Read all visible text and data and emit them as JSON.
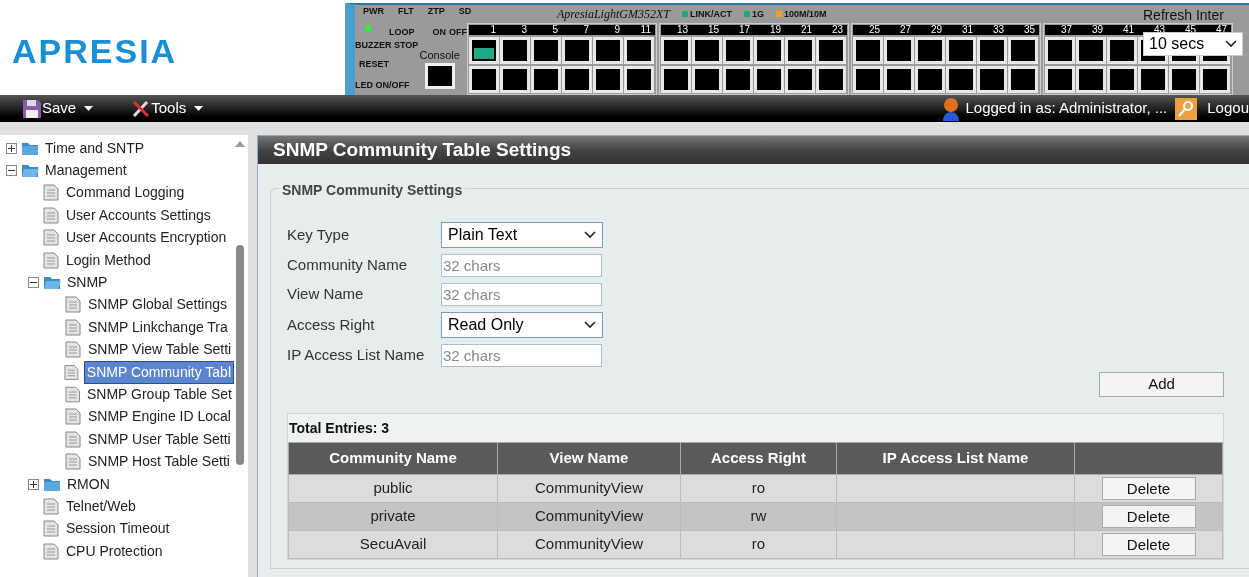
{
  "logo": "APRESIA",
  "device_panel": {
    "model": "ApresiaLightGM352XT",
    "leds": [
      "PWR",
      "FLT",
      "ZTP",
      "SD"
    ],
    "loop_label": "LOOP",
    "switch_labels": [
      "ON",
      "OFF"
    ],
    "buttons": [
      "BUZZER STOP",
      "RESET",
      "LED ON/OFF"
    ],
    "console": "Console",
    "legend": [
      {
        "label": "LINK/ACT",
        "color": "#22aa66"
      },
      {
        "label": "1G",
        "color": "#22aa66"
      },
      {
        "label": "100M/10M",
        "color": "#f0a020"
      }
    ],
    "port_groups": [
      {
        "ports": [
          {
            "label": "1",
            "link": true
          },
          {
            "label": "3",
            "link": false
          },
          {
            "label": "5",
            "link": false
          },
          {
            "label": "7",
            "link": false
          },
          {
            "label": "9",
            "link": false
          },
          {
            "label": "11",
            "link": false
          }
        ]
      },
      {
        "ports": [
          {
            "label": "13",
            "link": false
          },
          {
            "label": "15",
            "link": false
          },
          {
            "label": "17",
            "link": false
          },
          {
            "label": "19",
            "link": false
          },
          {
            "label": "21",
            "link": false
          },
          {
            "label": "23",
            "link": false
          }
        ]
      },
      {
        "ports": [
          {
            "label": "25",
            "link": false
          },
          {
            "label": "27",
            "link": false
          },
          {
            "label": "29",
            "link": false
          },
          {
            "label": "31",
            "link": false
          },
          {
            "label": "33",
            "link": false
          },
          {
            "label": "35",
            "link": false
          }
        ]
      },
      {
        "ports": [
          {
            "label": "37",
            "link": false
          },
          {
            "label": "39",
            "link": false
          },
          {
            "label": "41",
            "link": false
          },
          {
            "label": "43",
            "link": false
          },
          {
            "label": "45",
            "link": false
          },
          {
            "label": "47",
            "link": false
          }
        ]
      }
    ]
  },
  "refresh": {
    "label": "Refresh Inter",
    "value": "10 secs"
  },
  "toolbar": {
    "menus": [
      "Save",
      "Tools"
    ],
    "user": "Logged in as: Administrator, ...",
    "logout": "Logou"
  },
  "tree": [
    {
      "label": "Time and SNTP",
      "kind": "folder",
      "expanded": false,
      "selected": false
    },
    {
      "label": "Management",
      "kind": "folder",
      "expanded": true,
      "selected": false,
      "children": [
        {
          "label": "Command Logging",
          "kind": "page",
          "selected": false
        },
        {
          "label": "User Accounts Settings",
          "kind": "page",
          "selected": false
        },
        {
          "label": "User Accounts Encryption",
          "kind": "page",
          "selected": false
        },
        {
          "label": "Login Method",
          "kind": "page",
          "selected": false
        },
        {
          "label": "SNMP",
          "kind": "folder",
          "expanded": true,
          "selected": false,
          "children": [
            {
              "label": "SNMP Global Settings",
              "kind": "page",
              "selected": false
            },
            {
              "label": "SNMP Linkchange Tra",
              "kind": "page",
              "selected": false
            },
            {
              "label": "SNMP View Table Setti",
              "kind": "page",
              "selected": false
            },
            {
              "label": "SNMP Community Tabl",
              "kind": "page",
              "selected": true
            },
            {
              "label": "SNMP Group Table Set",
              "kind": "page",
              "selected": false
            },
            {
              "label": "SNMP Engine ID Local",
              "kind": "page",
              "selected": false
            },
            {
              "label": "SNMP User Table Setti",
              "kind": "page",
              "selected": false
            },
            {
              "label": "SNMP Host Table Setti",
              "kind": "page",
              "selected": false
            }
          ]
        },
        {
          "label": "RMON",
          "kind": "folder",
          "expanded": false,
          "selected": false
        },
        {
          "label": "Telnet/Web",
          "kind": "page",
          "selected": false
        },
        {
          "label": "Session Timeout",
          "kind": "page",
          "selected": false
        },
        {
          "label": "CPU Protection",
          "kind": "page",
          "selected": false
        }
      ]
    }
  ],
  "page_title": "SNMP Community Table Settings",
  "fieldset": {
    "legend": "SNMP Community Settings",
    "fields": [
      {
        "label": "Key Type",
        "kind": "select",
        "value": "Plain Text"
      },
      {
        "label": "Community Name",
        "kind": "text",
        "placeholder": "32 chars"
      },
      {
        "label": "View Name",
        "kind": "text",
        "placeholder": "32 chars"
      },
      {
        "label": "Access Right",
        "kind": "select",
        "value": "Read Only"
      },
      {
        "label": "IP Access List Name",
        "kind": "text",
        "placeholder": "32 chars"
      }
    ],
    "button": "Add"
  },
  "table": {
    "total": "Total Entries: 3",
    "columns": [
      "Community Name",
      "View Name",
      "Access Right",
      "IP Access List Name"
    ],
    "rows": [
      {
        "cells": [
          "public",
          "CommunityView",
          "ro",
          ""
        ],
        "action": "Delete"
      },
      {
        "cells": [
          "private",
          "CommunityView",
          "rw",
          ""
        ],
        "action": "Delete"
      },
      {
        "cells": [
          "SecuAvail",
          "CommunityView",
          "ro",
          ""
        ],
        "action": "Delete"
      }
    ]
  }
}
